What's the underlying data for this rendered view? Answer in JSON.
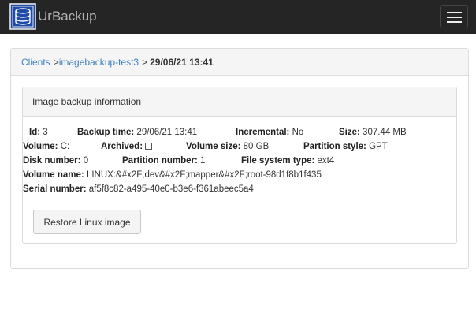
{
  "app": {
    "title": "UrBackup"
  },
  "icons": {
    "logo": "urbackup-database-icon",
    "menu": "hamburger-menu-icon"
  },
  "colors": {
    "navbar": "#252525",
    "link": "#3f7fbf",
    "panel_heading": "#f5f5f5"
  },
  "breadcrumb": {
    "clients": "Clients",
    "sep1": ">",
    "client": "imagebackup-test3",
    "sep2": ">",
    "current": "29/06/21 13:41"
  },
  "panel": {
    "title": "Image backup information"
  },
  "info": {
    "id": {
      "label": "Id:",
      "value": "3"
    },
    "backup_time": {
      "label": "Backup time:",
      "value": "29/06/21 13:41"
    },
    "incremental": {
      "label": "Incremental:",
      "value": "No"
    },
    "size": {
      "label": "Size:",
      "value": "307.44 MB"
    },
    "volume": {
      "label": "Volume:",
      "value": "C:"
    },
    "archived": {
      "label": "Archived:",
      "checked": false
    },
    "volume_size": {
      "label": "Volume size:",
      "value": "80 GB"
    },
    "partition_style": {
      "label": "Partition style:",
      "value": "GPT"
    },
    "disk_number": {
      "label": "Disk number:",
      "value": "0"
    },
    "partition_number": {
      "label": "Partition number:",
      "value": "1"
    },
    "fs_type": {
      "label": "File system type:",
      "value": "ext4"
    },
    "volume_name": {
      "label": "Volume name:",
      "value": "LINUX:&#x2F;dev&#x2F;mapper&#x2F;root-98d1f8b1f435"
    },
    "serial": {
      "label": "Serial number:",
      "value": "af5f8c82-a495-40e0-b3e6-f361abeec5a4"
    }
  },
  "actions": {
    "restore_label": "Restore Linux image"
  }
}
